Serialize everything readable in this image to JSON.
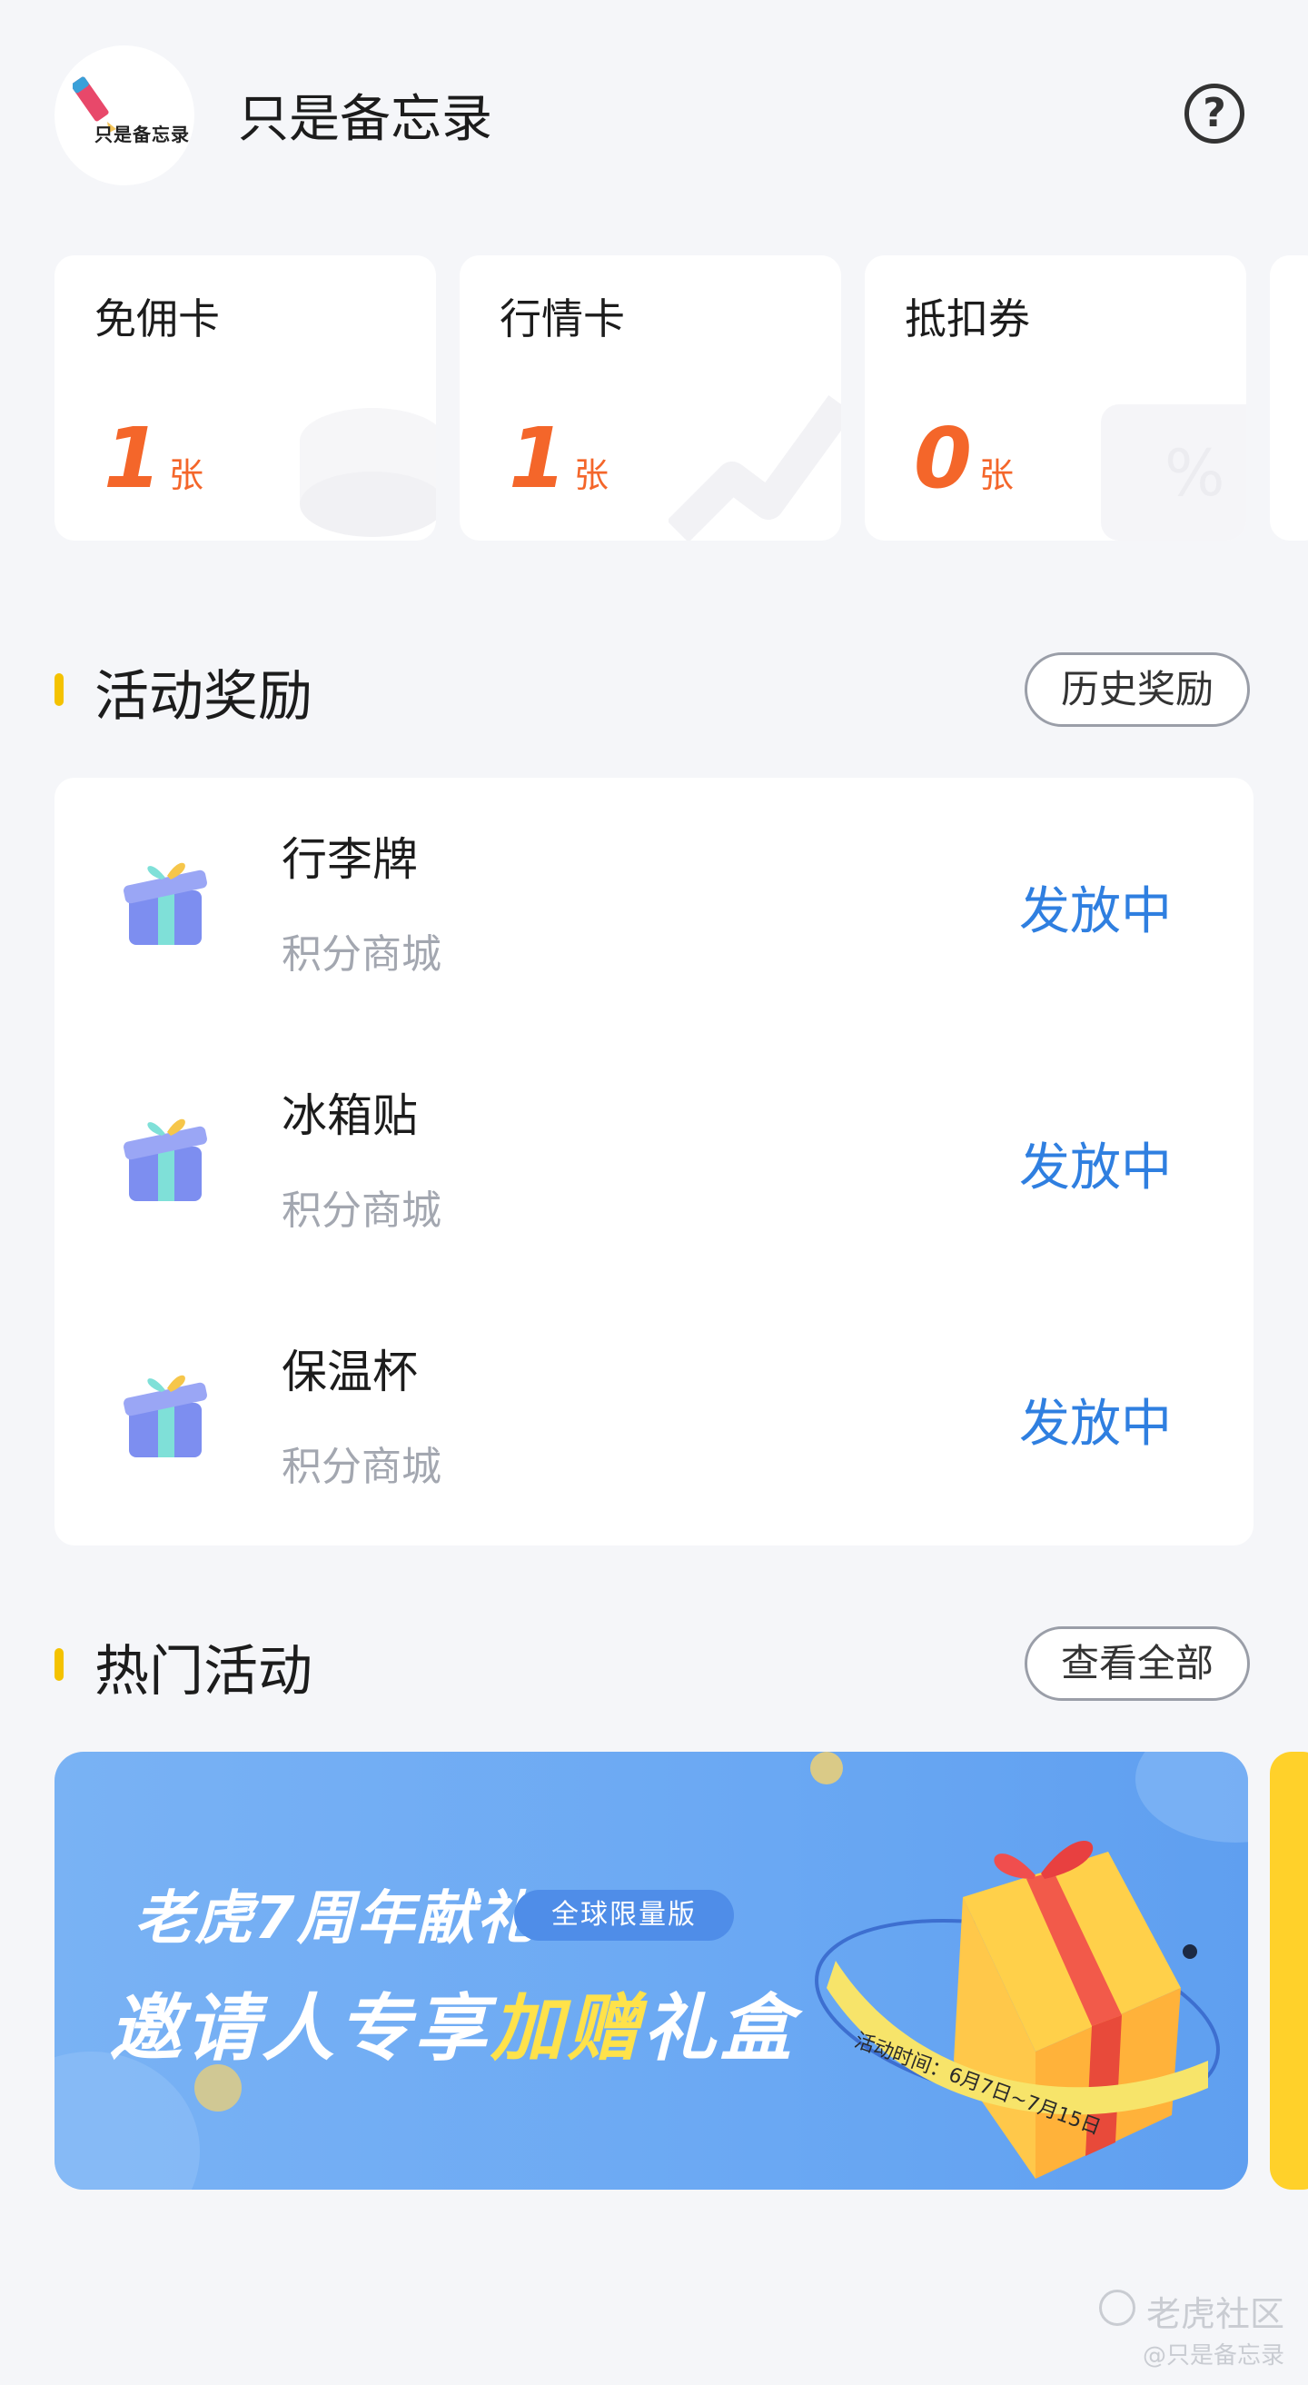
{
  "header": {
    "avatar_text": "只是备忘录",
    "username": "只是备忘录",
    "help_label": "?"
  },
  "cards": [
    {
      "title": "免佣卡",
      "count": "1",
      "unit": "张"
    },
    {
      "title": "行情卡",
      "count": "1",
      "unit": "张"
    },
    {
      "title": "抵扣券",
      "count": "0",
      "unit": "张"
    }
  ],
  "rewards_section": {
    "title": "活动奖励",
    "history_button": "历史奖励",
    "items": [
      {
        "name": "行李牌",
        "source": "积分商城",
        "status": "发放中"
      },
      {
        "name": "冰箱贴",
        "source": "积分商城",
        "status": "发放中"
      },
      {
        "name": "保温杯",
        "source": "积分商城",
        "status": "发放中"
      }
    ]
  },
  "hot_section": {
    "title": "热门活动",
    "view_all_button": "查看全部",
    "banner": {
      "line1": "老虎7周年献礼",
      "tag": "全球限量版",
      "line2_a": "邀请人专享",
      "line2_b": "加赠",
      "line2_c": "礼盒",
      "time_label": "活动时间：6月7日~7月15日"
    }
  },
  "watermark": {
    "brand": "老虎社区",
    "handle": "@只是备忘录"
  },
  "colors": {
    "accent_orange": "#f4662a",
    "status_blue": "#2f7fe0",
    "section_bar": "#f4c200",
    "banner_blue": "#6aa8f3"
  }
}
